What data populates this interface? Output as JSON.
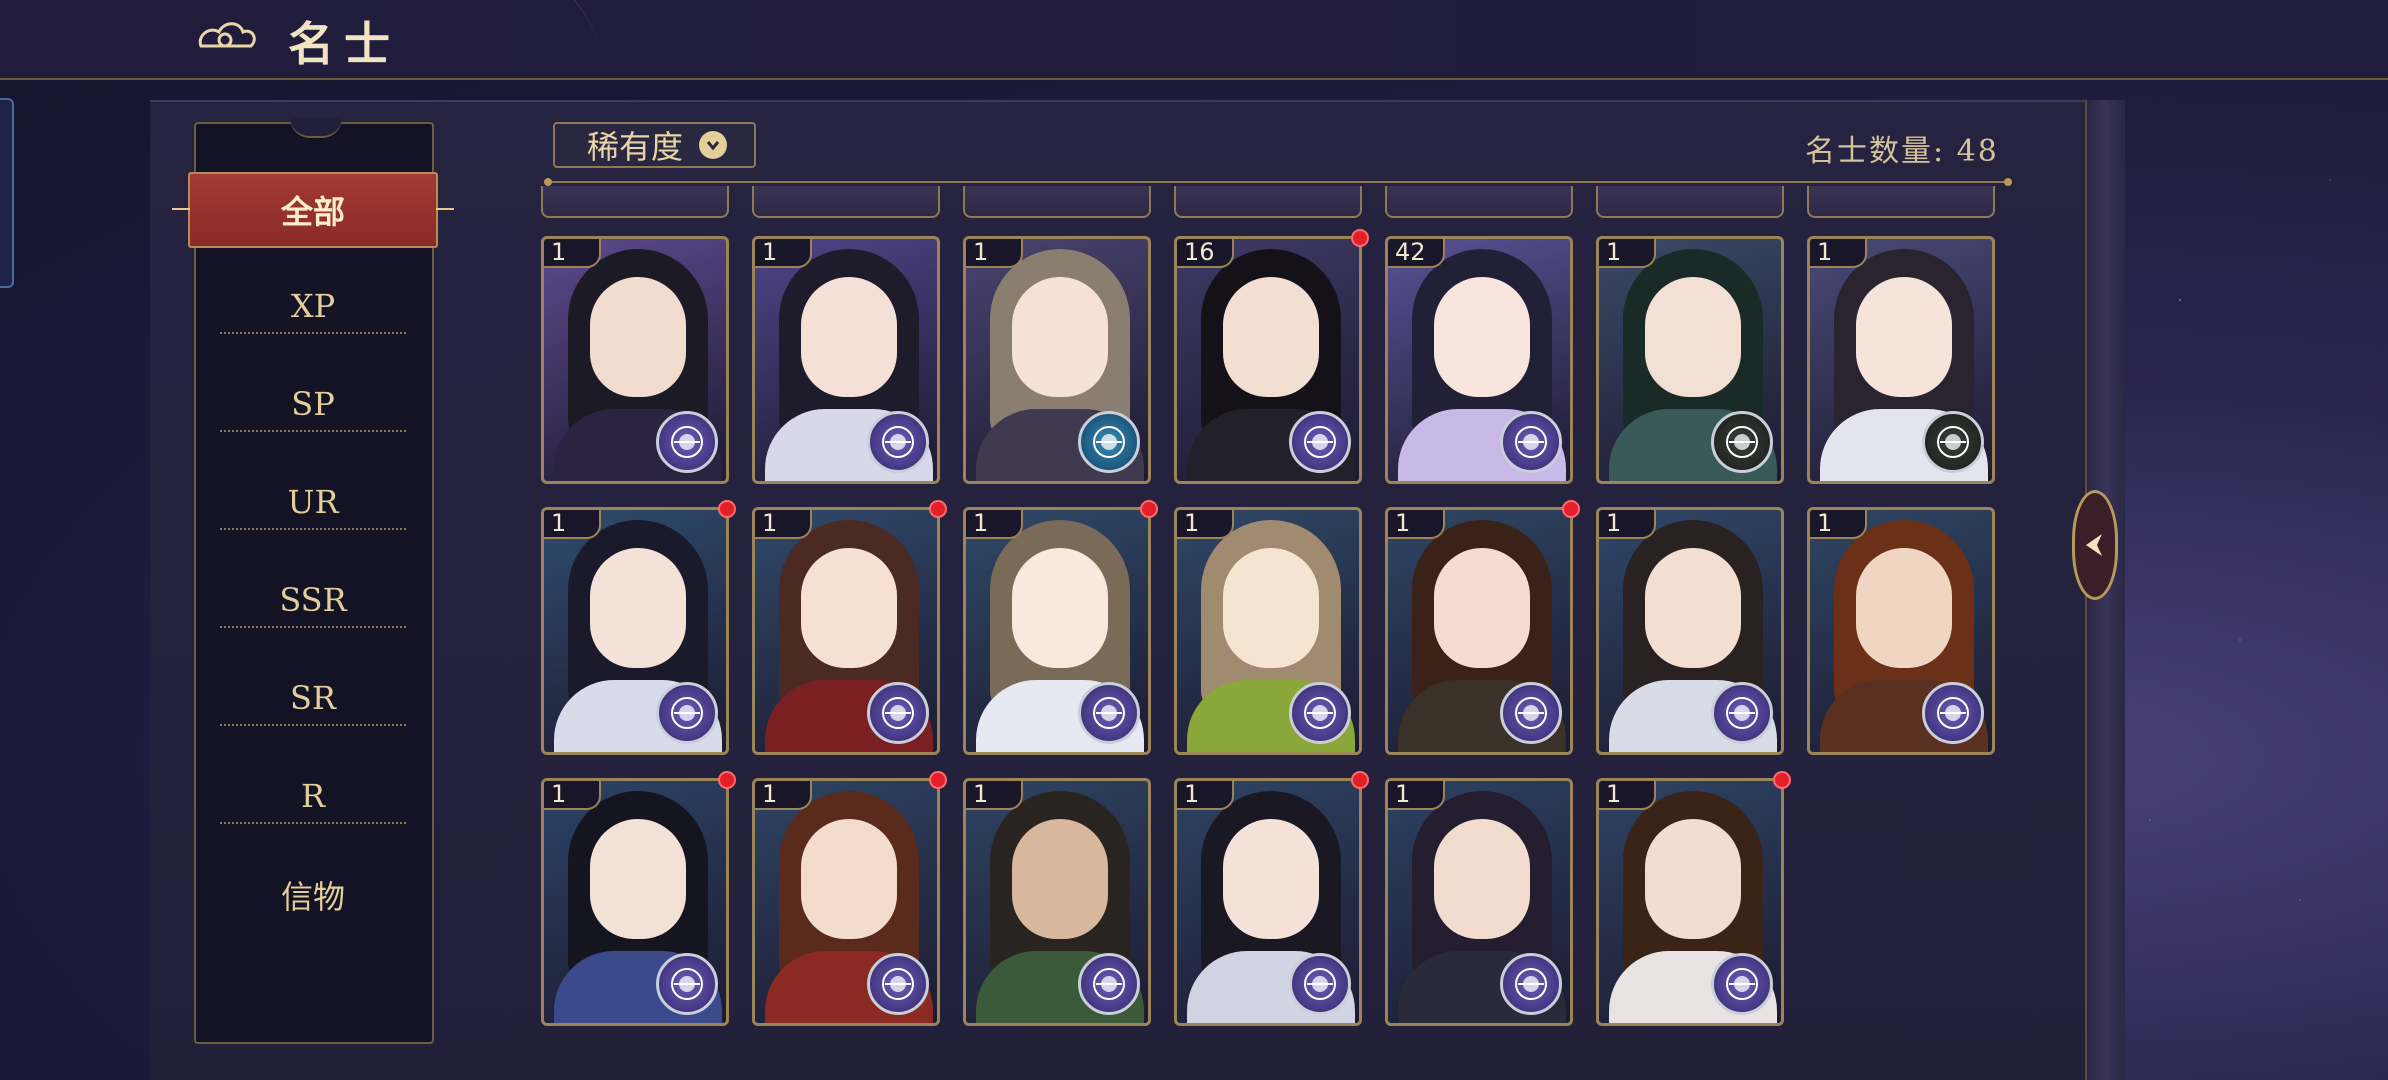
{
  "header": {
    "title": "名士"
  },
  "sidebar": {
    "items": [
      {
        "label": "全部",
        "active": true
      },
      {
        "label": "XP"
      },
      {
        "label": "SP"
      },
      {
        "label": "UR"
      },
      {
        "label": "SSR"
      },
      {
        "label": "SR"
      },
      {
        "label": "R"
      },
      {
        "label": "信物"
      }
    ]
  },
  "filter": {
    "rarity_label": "稀有度"
  },
  "stats": {
    "count_text": "名士数量: 48"
  },
  "cards": [
    {
      "level": "1",
      "emblem": "purple",
      "new": false
    },
    {
      "level": "1",
      "emblem": "purple",
      "new": false
    },
    {
      "level": "1",
      "emblem": "teal",
      "new": false
    },
    {
      "level": "16",
      "emblem": "purple",
      "new": true
    },
    {
      "level": "42",
      "emblem": "purple",
      "new": false
    },
    {
      "level": "1",
      "emblem": "dark",
      "new": false
    },
    {
      "level": "1",
      "emblem": "dark",
      "new": false
    },
    {
      "level": "1",
      "emblem": "purple",
      "new": true
    },
    {
      "level": "1",
      "emblem": "purple",
      "new": true
    },
    {
      "level": "1",
      "emblem": "purple",
      "new": true
    },
    {
      "level": "1",
      "emblem": "purple",
      "new": false
    },
    {
      "level": "1",
      "emblem": "purple",
      "new": true
    },
    {
      "level": "1",
      "emblem": "purple",
      "new": false
    },
    {
      "level": "1",
      "emblem": "purple",
      "new": false
    },
    {
      "level": "1",
      "emblem": "purple",
      "new": true
    },
    {
      "level": "1",
      "emblem": "purple",
      "new": true
    },
    {
      "level": "1",
      "emblem": "purple",
      "new": false
    },
    {
      "level": "1",
      "emblem": "purple",
      "new": true
    },
    {
      "level": "1",
      "emblem": "purple",
      "new": false
    },
    {
      "level": "1",
      "emblem": "purple",
      "new": true
    }
  ],
  "colors": {
    "accent_gold": "#9a8458",
    "active_tab_red": "#a33a32",
    "notify_red": "#e2202a"
  }
}
